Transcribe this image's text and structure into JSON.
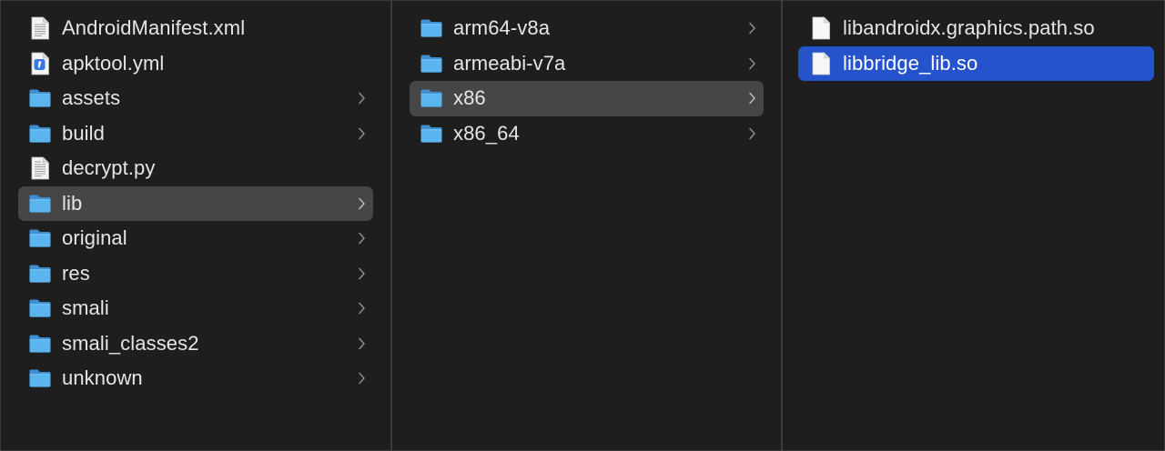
{
  "columns": [
    {
      "items": [
        {
          "label": "AndroidManifest.xml",
          "icon": "xml-document-icon",
          "has_children": false,
          "selected": "none"
        },
        {
          "label": "apktool.yml",
          "icon": "yaml-file-icon",
          "has_children": false,
          "selected": "none"
        },
        {
          "label": "assets",
          "icon": "folder-icon",
          "has_children": true,
          "selected": "none"
        },
        {
          "label": "build",
          "icon": "folder-icon",
          "has_children": true,
          "selected": "none"
        },
        {
          "label": "decrypt.py",
          "icon": "text-document-icon",
          "has_children": false,
          "selected": "none"
        },
        {
          "label": "lib",
          "icon": "folder-icon",
          "has_children": true,
          "selected": "inactive"
        },
        {
          "label": "original",
          "icon": "folder-icon",
          "has_children": true,
          "selected": "none"
        },
        {
          "label": "res",
          "icon": "folder-icon",
          "has_children": true,
          "selected": "none"
        },
        {
          "label": "smali",
          "icon": "folder-icon",
          "has_children": true,
          "selected": "none"
        },
        {
          "label": "smali_classes2",
          "icon": "folder-icon",
          "has_children": true,
          "selected": "none"
        },
        {
          "label": "unknown",
          "icon": "folder-icon",
          "has_children": true,
          "selected": "none"
        }
      ]
    },
    {
      "items": [
        {
          "label": "arm64-v8a",
          "icon": "folder-icon",
          "has_children": true,
          "selected": "none"
        },
        {
          "label": "armeabi-v7a",
          "icon": "folder-icon",
          "has_children": true,
          "selected": "none"
        },
        {
          "label": "x86",
          "icon": "folder-icon",
          "has_children": true,
          "selected": "inactive"
        },
        {
          "label": "x86_64",
          "icon": "folder-icon",
          "has_children": true,
          "selected": "none"
        }
      ]
    },
    {
      "items": [
        {
          "label": "libandroidx.graphics.path.so",
          "icon": "blank-document-icon",
          "has_children": false,
          "selected": "none"
        },
        {
          "label": "libbridge_lib.so",
          "icon": "blank-document-icon",
          "has_children": false,
          "selected": "active"
        }
      ]
    }
  ],
  "colors": {
    "background": "#1e1e1e",
    "selection_active": "#2553cc",
    "selection_inactive": "#464646",
    "folder": "#5ab4ee",
    "text": "#e6e6e6"
  }
}
